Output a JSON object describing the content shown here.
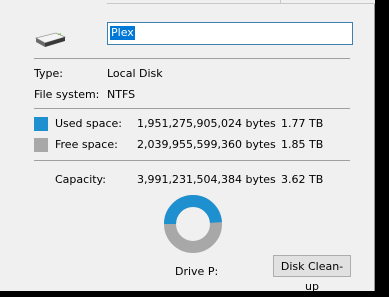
{
  "drive": {
    "name_value": "Plex",
    "type_label": "Type:",
    "type_value": "Local Disk",
    "fs_label": "File system:",
    "fs_value": "NTFS"
  },
  "usage": {
    "used_label": "Used space:",
    "used_bytes": "1,951,275,905,024 bytes",
    "used_size": "1.77 TB",
    "free_label": "Free space:",
    "free_bytes": "2,039,955,599,360 bytes",
    "free_size": "1.85 TB",
    "capacity_label": "Capacity:",
    "capacity_bytes": "3,991,231,504,384 bytes",
    "capacity_size": "3.62 TB",
    "used_fraction": 0.489,
    "used_color": "#1e90cf",
    "free_color": "#a8a8a8"
  },
  "footer": {
    "drive_label": "Drive P:",
    "cleanup_button": "Disk Clean-up"
  },
  "icons": {
    "drive": "hard-drive-icon"
  }
}
